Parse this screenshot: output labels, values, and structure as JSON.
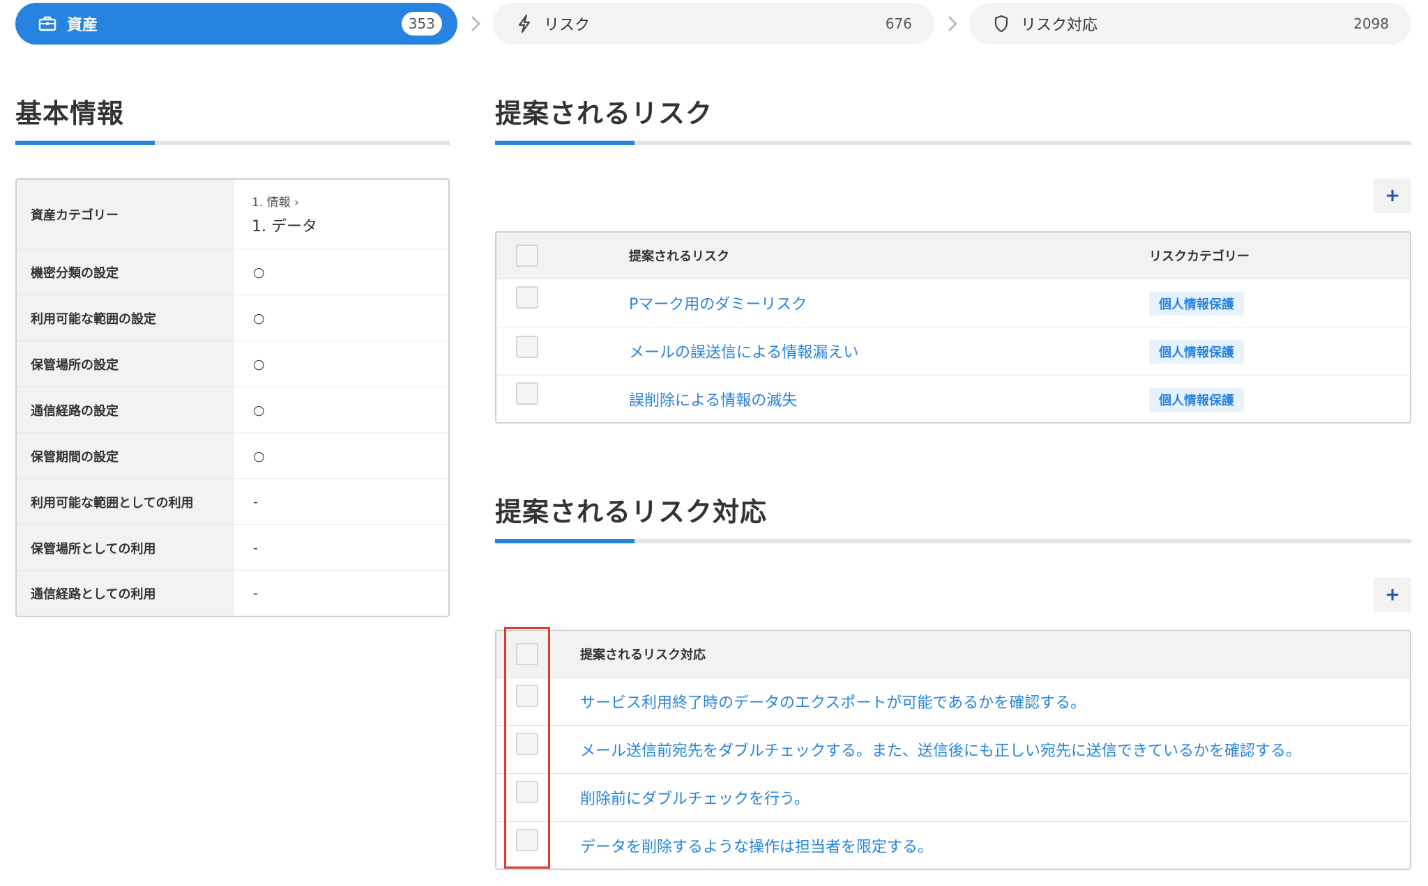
{
  "steps": [
    {
      "label": "資産",
      "count": "353",
      "icon": "briefcase-icon"
    },
    {
      "label": "リスク",
      "count": "676",
      "icon": "lightning-icon"
    },
    {
      "label": "リスク対応",
      "count": "2098",
      "icon": "shield-icon"
    }
  ],
  "basic_info": {
    "title": "基本情報",
    "rows": [
      {
        "key": "資産カテゴリー",
        "parent": "1. 情報",
        "value": "1. データ"
      },
      {
        "key": "機密分類の設定",
        "value": "○"
      },
      {
        "key": "利用可能な範囲の設定",
        "value": "○"
      },
      {
        "key": "保管場所の設定",
        "value": "○"
      },
      {
        "key": "通信経路の設定",
        "value": "○"
      },
      {
        "key": "保管期間の設定",
        "value": "○"
      },
      {
        "key": "利用可能な範囲としての利用",
        "value": "-"
      },
      {
        "key": "保管場所としての利用",
        "value": "-"
      },
      {
        "key": "通信経路としての利用",
        "value": "-"
      }
    ]
  },
  "suggested_risks": {
    "title": "提案されるリスク",
    "add_label": "+",
    "columns": [
      "提案されるリスク",
      "リスクカテゴリー"
    ],
    "rows": [
      {
        "name": "Pマーク用のダミーリスク",
        "category": "個人情報保護"
      },
      {
        "name": "メールの誤送信による情報漏えい",
        "category": "個人情報保護"
      },
      {
        "name": "誤削除による情報の滅失",
        "category": "個人情報保護"
      }
    ]
  },
  "suggested_measures": {
    "title": "提案されるリスク対応",
    "add_label": "+",
    "columns": [
      "提案されるリスク対応"
    ],
    "rows": [
      {
        "name": "サービス利用終了時のデータのエクスポートが可能であるかを確認する。"
      },
      {
        "name": "メール送信前宛先をダブルチェックする。また、送信後にも正しい宛先に送信できているかを確認する。"
      },
      {
        "name": "削除前にダブルチェックを行う。"
      },
      {
        "name": "データを削除するような操作は担当者を限定する。"
      }
    ]
  },
  "colors": {
    "accent": "#2684e0",
    "highlight": "#e03a2e"
  }
}
